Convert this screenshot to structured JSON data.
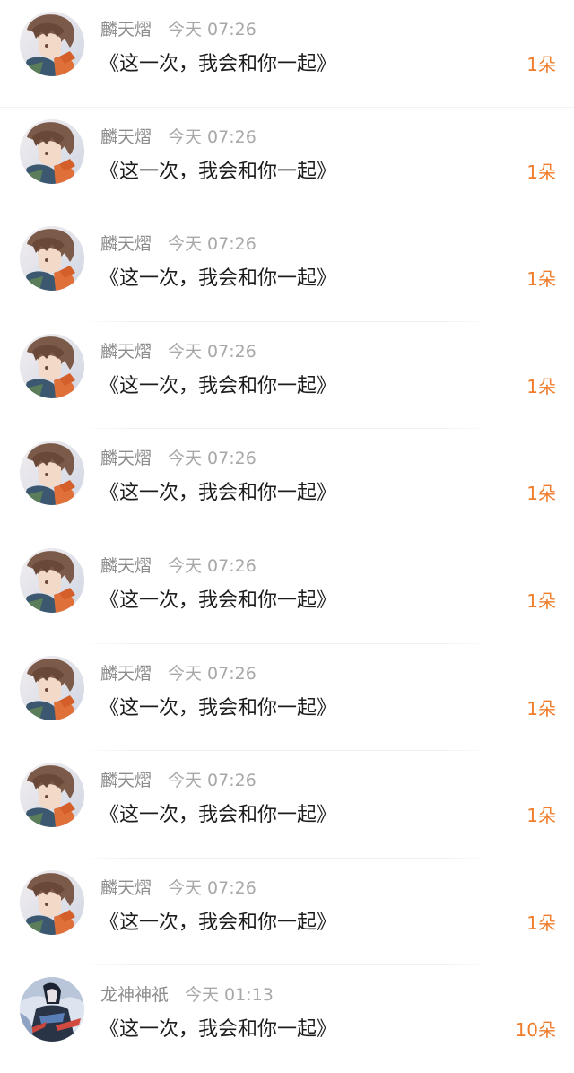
{
  "records": [
    {
      "user": "麟天熠",
      "time": "今天 07:26",
      "title": "《这一次，我会和你一起》",
      "gift": "1朵",
      "avatar": "anime-boy"
    },
    {
      "user": "麟天熠",
      "time": "今天 07:26",
      "title": "《这一次，我会和你一起》",
      "gift": "1朵",
      "avatar": "anime-boy"
    },
    {
      "user": "麟天熠",
      "time": "今天 07:26",
      "title": "《这一次，我会和你一起》",
      "gift": "1朵",
      "avatar": "anime-boy"
    },
    {
      "user": "麟天熠",
      "time": "今天 07:26",
      "title": "《这一次，我会和你一起》",
      "gift": "1朵",
      "avatar": "anime-boy"
    },
    {
      "user": "麟天熠",
      "time": "今天 07:26",
      "title": "《这一次，我会和你一起》",
      "gift": "1朵",
      "avatar": "anime-boy"
    },
    {
      "user": "麟天熠",
      "time": "今天 07:26",
      "title": "《这一次，我会和你一起》",
      "gift": "1朵",
      "avatar": "anime-boy"
    },
    {
      "user": "麟天熠",
      "time": "今天 07:26",
      "title": "《这一次，我会和你一起》",
      "gift": "1朵",
      "avatar": "anime-boy"
    },
    {
      "user": "麟天熠",
      "time": "今天 07:26",
      "title": "《这一次，我会和你一起》",
      "gift": "1朵",
      "avatar": "anime-boy"
    },
    {
      "user": "麟天熠",
      "time": "今天 07:26",
      "title": "《这一次，我会和你一起》",
      "gift": "1朵",
      "avatar": "anime-boy"
    },
    {
      "user": "龙神神祇",
      "time": "今天 01:13",
      "title": "《这一次，我会和你一起》",
      "gift": "10朵",
      "avatar": "dark-warrior"
    }
  ],
  "colors": {
    "gift_accent": "#f07d2c",
    "title_text": "#1d1d1d",
    "meta_text": "#8d8d8d"
  }
}
